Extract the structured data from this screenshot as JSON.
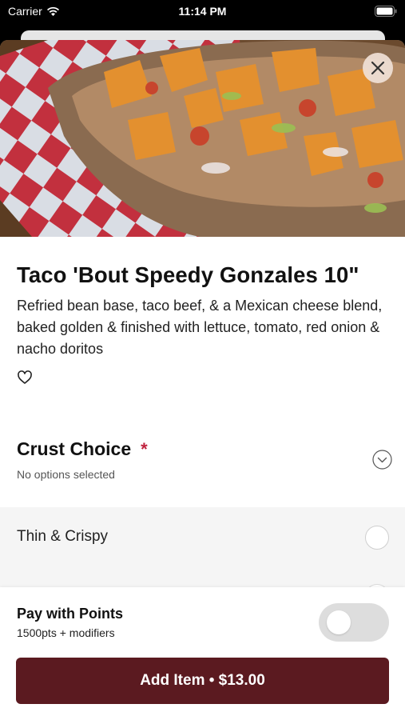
{
  "status_bar": {
    "carrier": "Carrier",
    "time": "11:14 PM"
  },
  "item": {
    "title": "Taco 'Bout Speedy Gonzales 10\"",
    "description": "Refried bean base, taco beef, & a Mexican cheese blend, baked golden & finished with lettuce, tomato, red onion & nacho doritos",
    "icons": {
      "close": "close-icon",
      "favorite": "heart-outline-icon"
    }
  },
  "section": {
    "title": "Crust Choice",
    "required_mark": "*",
    "subtitle": "No options selected",
    "chevron_icon": "chevron-down-circle-icon"
  },
  "options": [
    {
      "label": "Thin & Crispy",
      "selected": false
    }
  ],
  "points": {
    "title": "Pay with Points",
    "subtitle": "1500pts + modifiers",
    "enabled": false
  },
  "add_button": {
    "label": "Add Item • $13.00"
  },
  "colors": {
    "accent": "#5b1a20",
    "required": "#c0223e"
  }
}
